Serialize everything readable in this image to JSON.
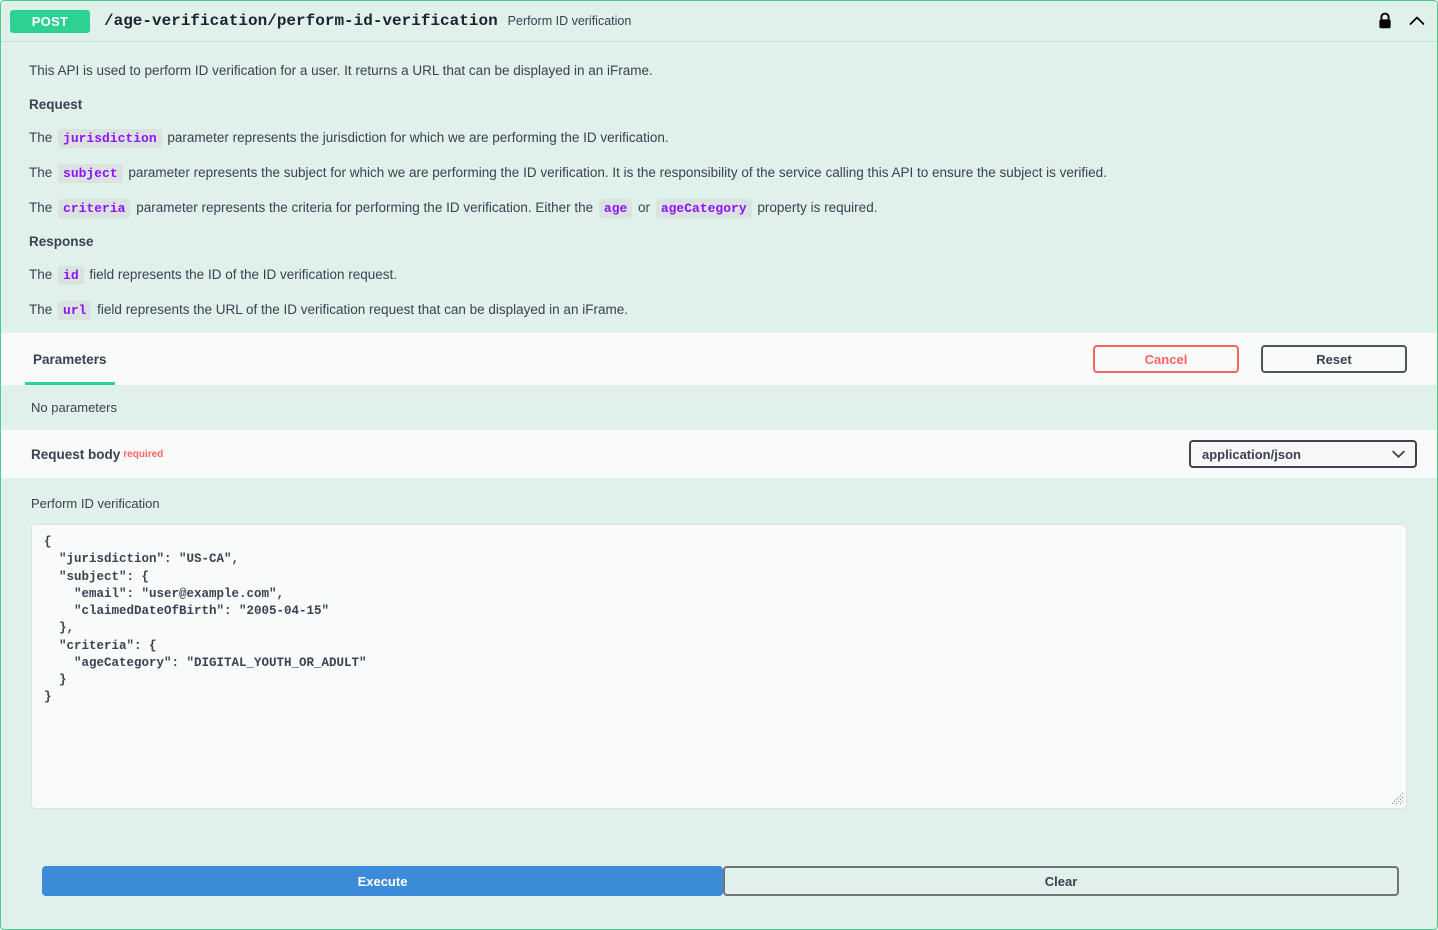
{
  "operation": {
    "method": "POST",
    "path": "/age-verification/perform-id-verification",
    "summary": "Perform ID verification",
    "lock_icon": "lock-closed-icon",
    "collapse_icon": "chevron-up-icon"
  },
  "description": {
    "intro": "This API is used to perform ID verification for a user. It returns a URL that can be displayed in an iFrame.",
    "request_heading": "Request",
    "request_lines": [
      {
        "before": "The ",
        "code": "jurisdiction",
        "after": " parameter represents the jurisdiction for which we are performing the ID verification."
      },
      {
        "before": "The ",
        "code": "subject",
        "after": " parameter represents the subject for which we are performing the ID verification. It is the responsibility of the service calling this API to ensure the subject is verified."
      },
      {
        "before": "The ",
        "code": "criteria",
        "after": " parameter represents the criteria for performing the ID verification. Either the ",
        "code2": "age",
        "mid": " or ",
        "code3": "ageCategory",
        "tail": " property is required."
      }
    ],
    "response_heading": "Response",
    "response_lines": [
      {
        "before": "The ",
        "code": "id",
        "after": " field represents the ID of the ID verification request."
      },
      {
        "before": "The ",
        "code": "url",
        "after": " field represents the URL of the ID verification request that can be displayed in an iFrame."
      }
    ]
  },
  "tabs": {
    "parameters_label": "Parameters",
    "cancel_label": "Cancel",
    "reset_label": "Reset"
  },
  "parameters": {
    "empty_text": "No parameters"
  },
  "request_body": {
    "title": "Request body",
    "required_label": "required",
    "content_type_selected": "application/json",
    "content_type_options": [
      "application/json"
    ],
    "dropdown_icon": "chevron-down-icon",
    "editor_label": "Perform ID verification",
    "editor_value": "{\n  \"jurisdiction\": \"US-CA\",\n  \"subject\": {\n    \"email\": \"user@example.com\",\n    \"claimedDateOfBirth\": \"2005-04-15\"\n  },\n  \"criteria\": {\n    \"ageCategory\": \"DIGITAL_YOUTH_OR_ADULT\"\n  }\n}",
    "resize_handle_icon": "resize-grip-icon"
  },
  "actions": {
    "execute_label": "Execute",
    "clear_label": "Clear"
  },
  "colors": {
    "method_post": "#2fd193",
    "panel_border": "#49cc90",
    "panel_bg": "#e0f0ea",
    "row_bg_alt": "#f9fbfa",
    "code_text": "#9012fe",
    "required_red": "#ff6060",
    "execute_blue": "#3b8bd9",
    "text": "#3b4151"
  }
}
